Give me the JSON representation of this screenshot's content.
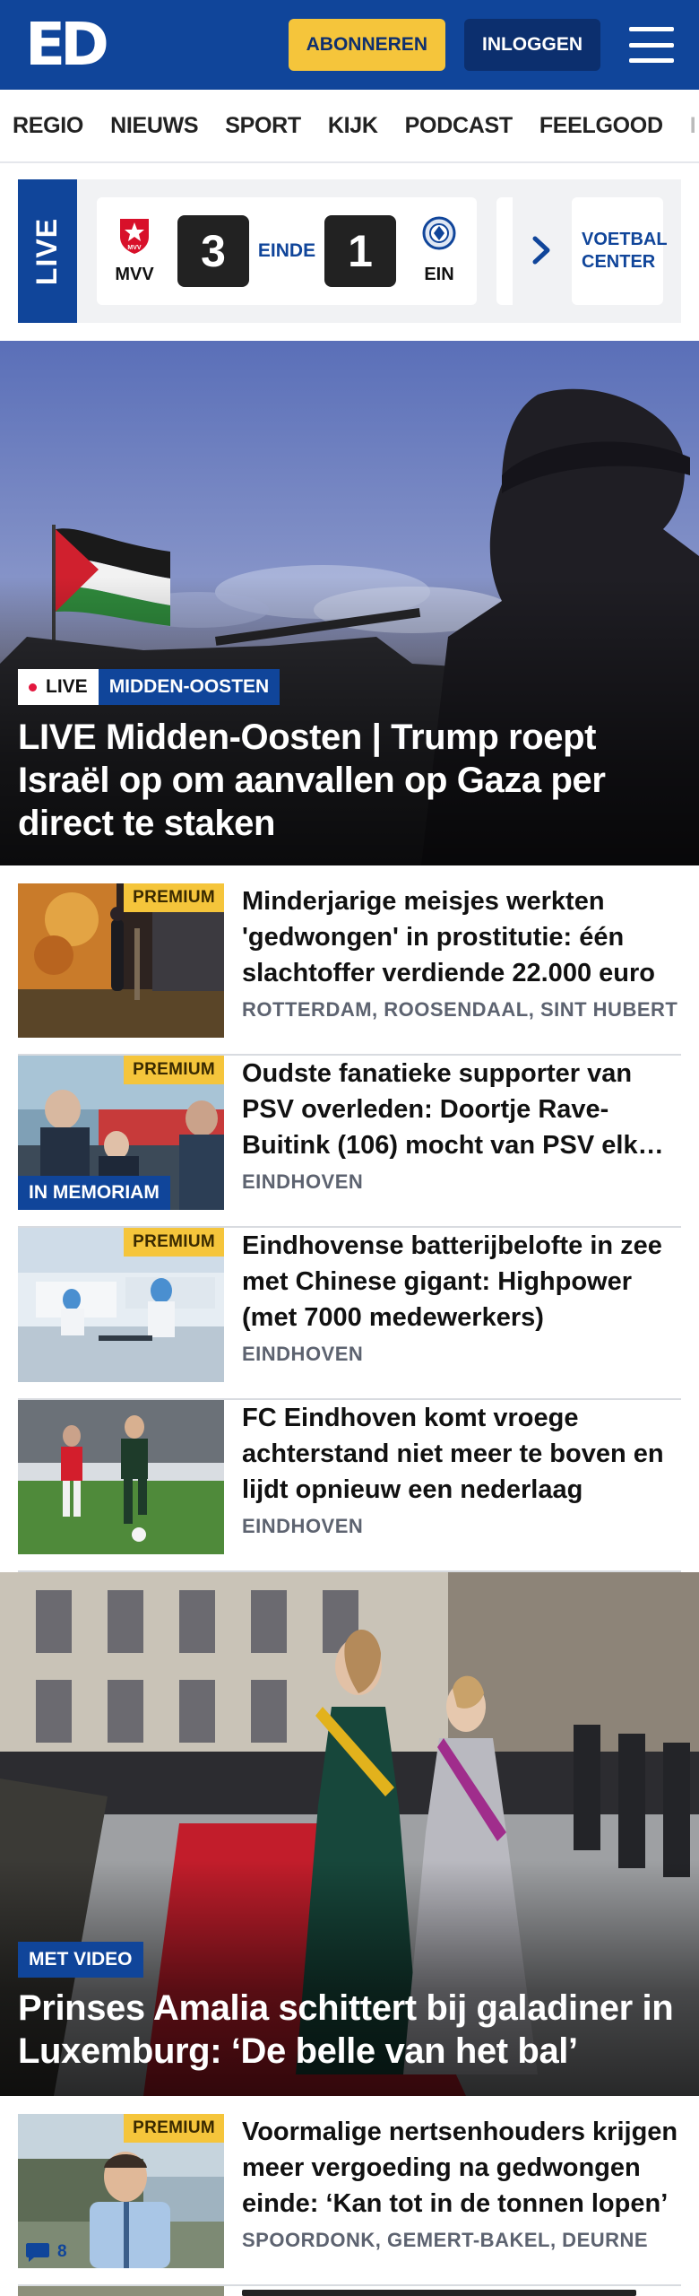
{
  "header": {
    "logo": "ED",
    "subscribe_label": "ABONNEREN",
    "login_label": "INLOGGEN",
    "menu_icon": "hamburger-icon"
  },
  "nav": {
    "items": [
      "REGIO",
      "NIEUWS",
      "SPORT",
      "KIJK",
      "PODCAST",
      "FEELGOOD",
      "I"
    ]
  },
  "live_scores": {
    "tag": "LIVE",
    "match": {
      "home_abbr": "MVV",
      "home_score": "3",
      "status": "EINDE",
      "away_score": "1",
      "away_abbr": "EIN"
    },
    "voetbal_center_label": "VOETBAL CENTER",
    "arrow_icon": "chevron-right-icon"
  },
  "hero": {
    "live_label": "LIVE",
    "category": "MIDDEN-OOSTEN",
    "title": "LIVE Midden-Oosten | Trump roept Israël op om aanvallen op Gaza per direct te staken"
  },
  "articles": [
    {
      "premium": "PREMIUM",
      "headline": "Minderjarige meisjes werkten 'gedwongen' in prostitutie: één slachtoffer verdiende 22.000 euro",
      "place": "ROTTERDAM, ROOSENDAAL, SINT HUBERT"
    },
    {
      "premium": "PREMIUM",
      "badge": "IN MEMORIAM",
      "headline": "Oudste fanatieke supporter van PSV overleden: Doortje Rave-Buitink (106) mocht van PSV elk jaar",
      "place": "EINDHOVEN"
    },
    {
      "premium": "PREMIUM",
      "headline": "Eindhovense batterijbelofte in zee met Chinese gigant: Highpower (met 7000 medewerkers)",
      "place": "EINDHOVEN"
    },
    {
      "headline": "FC Eindhoven komt vroege achterstand niet meer te boven en lijdt opnieuw een nederlaag",
      "place": "EINDHOVEN"
    }
  ],
  "feature": {
    "label": "MET VIDEO",
    "title": "Prinses Amalia schittert bij galadiner in Luxemburg: ‘De belle van het bal’"
  },
  "article_after": {
    "premium": "PREMIUM",
    "comments": "8",
    "comment_icon": "comment-bubble-icon",
    "headline": "Voormalige nertsenhouders krijgen meer vergoeding na gedwongen einde: ‘Kan tot in de tonnen lopen’",
    "place": "SPOORDONK, GEMERT-BAKEL, DEURNE"
  },
  "colors": {
    "brand_blue": "#10459a",
    "premium_yellow": "#f5c53b",
    "live_red": "#e3173e"
  }
}
